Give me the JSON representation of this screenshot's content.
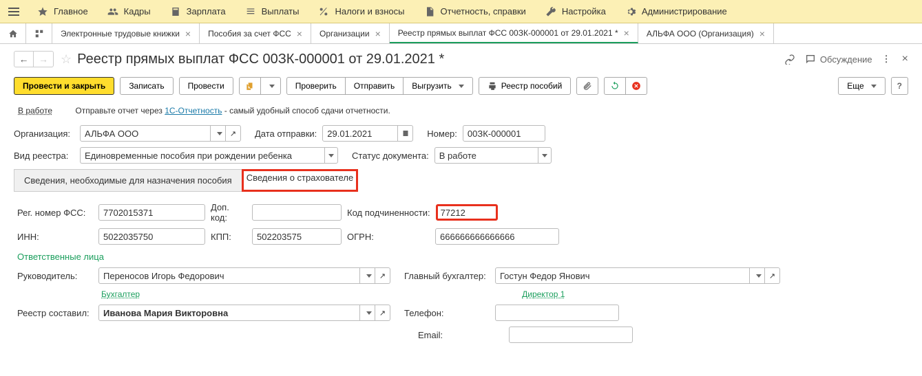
{
  "topmenu": {
    "items": [
      {
        "label": "Главное"
      },
      {
        "label": "Кадры"
      },
      {
        "label": "Зарплата"
      },
      {
        "label": "Выплаты"
      },
      {
        "label": "Налоги и взносы"
      },
      {
        "label": "Отчетность, справки"
      },
      {
        "label": "Настройка"
      },
      {
        "label": "Администрирование"
      }
    ]
  },
  "tabs": {
    "items": [
      {
        "label": "Электронные трудовые книжки"
      },
      {
        "label": "Пособия за счет ФСС"
      },
      {
        "label": "Организации"
      },
      {
        "label": "Реестр прямых выплат ФСС 00ЗК-000001 от 29.01.2021 *"
      },
      {
        "label": "АЛЬФА ООО (Организация)"
      }
    ]
  },
  "title": "Реестр прямых выплат ФСС 00ЗК-000001 от 29.01.2021 *",
  "title_actions": {
    "discuss": "Обсуждение"
  },
  "toolbar": {
    "commit": "Провести и закрыть",
    "save": "Записать",
    "post": "Провести",
    "check": "Проверить",
    "send": "Отправить",
    "export": "Выгрузить",
    "registry": "Реестр пособий",
    "more": "Еще"
  },
  "status": {
    "label": "В работе",
    "hint_pre": "Отправьте отчет через ",
    "hint_link": "1С-Отчетность",
    "hint_post": " - самый удобный способ сдачи отчетности."
  },
  "fields": {
    "org_label": "Организация:",
    "org_value": "АЛЬФА ООО",
    "send_date_label": "Дата отправки:",
    "send_date_value": "29.01.2021",
    "number_label": "Номер:",
    "number_value": "00ЗК-000001",
    "reg_type_label": "Вид реестра:",
    "reg_type_value": "Единовременные пособия при рождении ребенка",
    "doc_status_label": "Статус документа:",
    "doc_status_value": "В работе"
  },
  "inner_tabs": {
    "t1": "Сведения, необходимые для назначения пособия",
    "t2": "Сведения о страхователе"
  },
  "insurer": {
    "reg_fss_label": "Рег. номер ФСС:",
    "reg_fss_value": "7702015371",
    "extra_code_label": "Доп. код:",
    "extra_code_value": "",
    "sub_code_label": "Код подчиненности:",
    "sub_code_value": "77212",
    "inn_label": "ИНН:",
    "inn_value": "5022035750",
    "kpp_label": "КПП:",
    "kpp_value": "502203575",
    "ogrn_label": "ОГРН:",
    "ogrn_value": "666666666666666"
  },
  "persons": {
    "heading": "Ответственные лица",
    "head_label": "Руководитель:",
    "head_value": "Переносов Игорь Федорович",
    "chief_acc_label": "Главный бухгалтер:",
    "chief_acc_value": "Гостун Федор Янович",
    "accountant_link": "Бухгалтер",
    "director_link": "Директор 1",
    "compiled_label": "Реестр составил:",
    "compiled_value": "Иванова Мария Викторовна",
    "phone_label": "Телефон:",
    "phone_value": "",
    "email_label": "Email:",
    "email_value": ""
  }
}
